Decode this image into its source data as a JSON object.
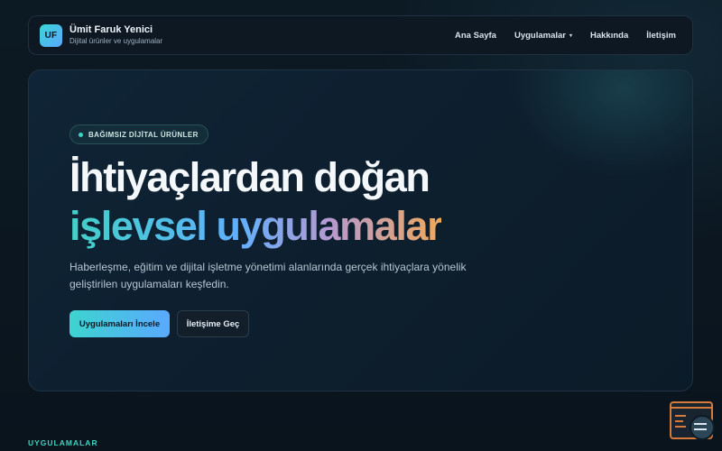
{
  "brand": {
    "logo_text": "UF",
    "name": "Ümit Faruk Yenici",
    "tagline": "Dijital ürünler ve uygulamalar"
  },
  "nav": {
    "items": [
      {
        "label": "Ana Sayfa"
      },
      {
        "label": "Uygulamalar",
        "has_dropdown": true,
        "caret": "▾"
      },
      {
        "label": "Hakkında"
      },
      {
        "label": "İletişim"
      }
    ]
  },
  "hero": {
    "badge": "BAĞIMSIZ DİJİTAL ÜRÜNLER",
    "title_line1": "İhtiyaçlardan doğan",
    "title_line2": "işlevsel uygulamalar",
    "description": "Haberleşme, eğitim ve dijital işletme yönetimi alanlarında gerçek ihtiyaçlara yönelik geliştirilen uygulamaları keşfedin.",
    "primary_cta": "Uygulamaları İncele",
    "secondary_cta": "İletişime Geç"
  },
  "section": {
    "label": "UYGULAMALAR"
  },
  "colors": {
    "accent_teal": "#3fd3c2",
    "accent_blue": "#5aa9ff",
    "accent_orange": "#f0a85a",
    "background": "#0b1620"
  },
  "icons": {
    "floating_widget": "app-window-search-icon"
  }
}
